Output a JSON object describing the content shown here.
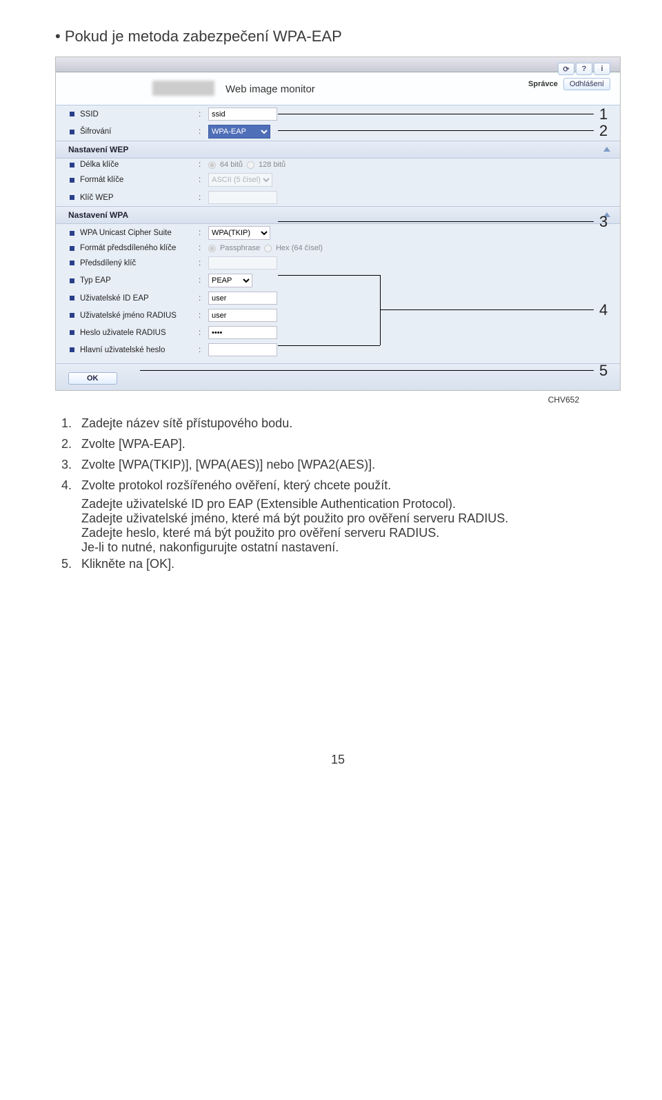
{
  "doc": {
    "bullet_title": "Pokud je metoda zabezpečení WPA-EAP",
    "ref": "CHV652",
    "page_number": "15"
  },
  "callouts": {
    "n1": "1",
    "n2": "2",
    "n3": "3",
    "n4": "4",
    "n5": "5"
  },
  "ui": {
    "app_title": "Web image monitor",
    "header_right": {
      "role": "Správce",
      "logout": "Odhlášení"
    },
    "icons": {
      "refresh": "⟳",
      "help": "?",
      "info": "i"
    },
    "rows": {
      "ssid_label": "SSID",
      "ssid_value": "ssid",
      "sifrovani_label": "Šifrování",
      "sifrovani_value": "WPA-EAP",
      "section_wep": "Nastavení WEP",
      "delka_label": "Délka klíče",
      "delka_opt1": "64 bitů",
      "delka_opt2": "128 bitů",
      "format_label": "Formát klíče",
      "format_value": "ASCII (5 čísel)",
      "klicwep_label": "Klíč WEP",
      "section_wpa": "Nastavení WPA",
      "cipher_label": "WPA Unicast Cipher Suite",
      "cipher_value": "WPA(TKIP)",
      "formatpred_label": "Formát předsdíleného klíče",
      "formatpred_opt1": "Passphrase",
      "formatpred_opt2": "Hex (64 čísel)",
      "predsdileny_label": "Předsdílený klíč",
      "typeap_label": "Typ EAP",
      "typeap_value": "PEAP",
      "uzivideap_label": "Uživatelské ID EAP",
      "uzivideap_value": "user",
      "uzivjmradius_label": "Uživatelské jméno RADIUS",
      "uzivjmradius_value": "user",
      "hesloradius_label": "Heslo uživatele RADIUS",
      "hesloradius_value": "••••",
      "hlavniheslo_label": "Hlavní uživatelské heslo",
      "ok": "OK"
    }
  },
  "instructions": {
    "i1": "Zadejte název sítě přístupového bodu.",
    "i2": "Zvolte [WPA-EAP].",
    "i3": "Zvolte [WPA(TKIP)], [WPA(AES)] nebo [WPA2(AES)].",
    "i4": "Zvolte protokol rozšířeného ověření, který chcete použít.",
    "i4a": "Zadejte uživatelské ID pro EAP (Extensible Authentication Protocol).",
    "i4b": "Zadejte uživatelské jméno, které má být použito pro ověření serveru RADIUS.",
    "i4c": "Zadejte heslo, které má být použito pro ověření serveru RADIUS.",
    "i4d": "Je-li to nutné, nakonfigurujte ostatní nastavení.",
    "i5": "Klikněte na [OK]."
  }
}
